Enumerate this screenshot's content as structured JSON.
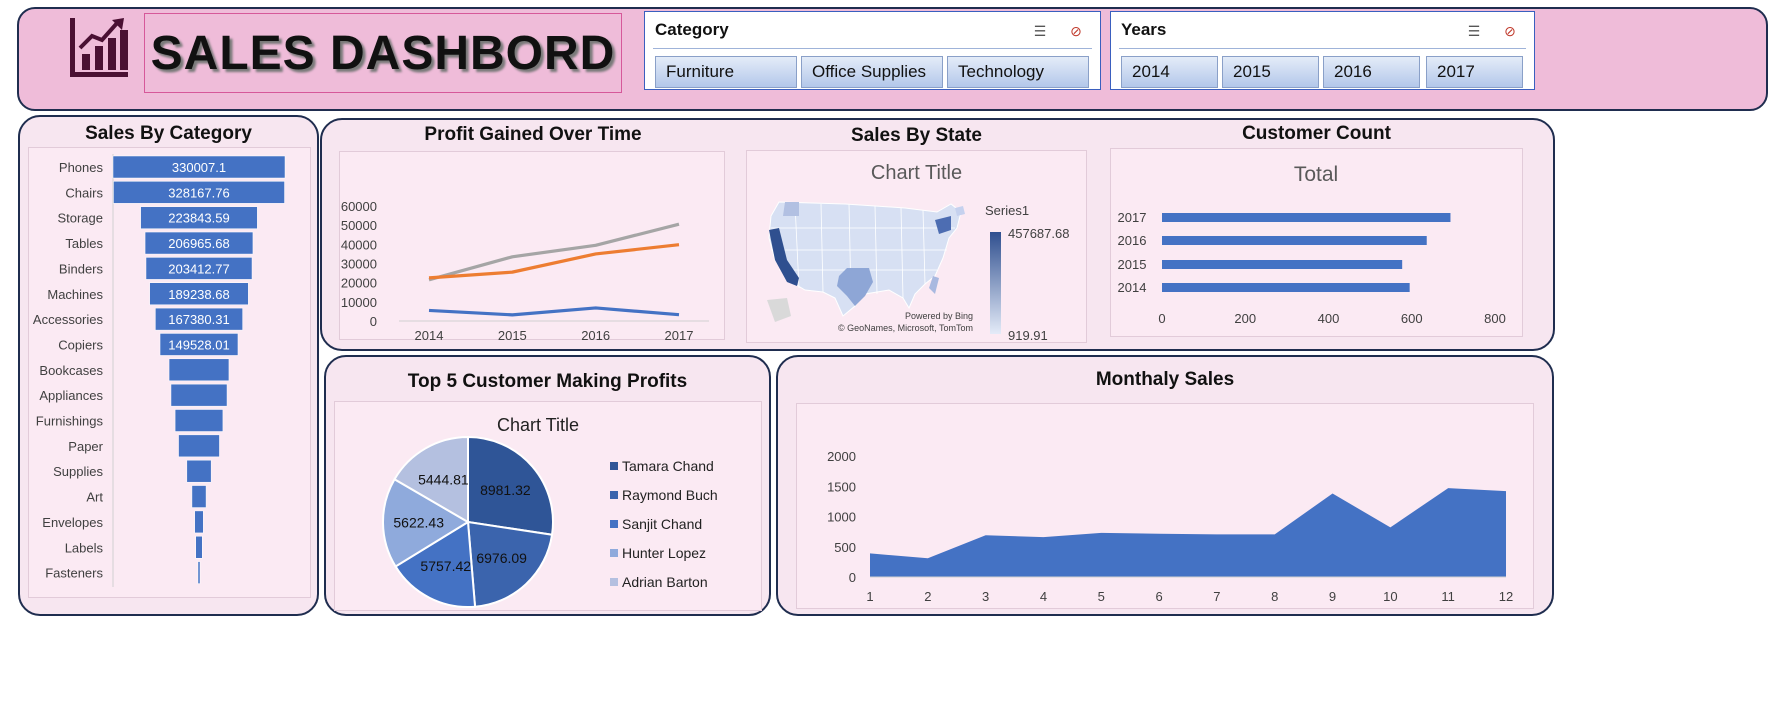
{
  "header": {
    "title": "SALES DASHBORD",
    "logo_icon": "bar-chart-growth-icon",
    "category_slicer": {
      "title": "Category",
      "items": [
        "Furniture",
        "Office Supplies",
        "Technology"
      ],
      "multiselect_icon": "multi-select-icon",
      "clear_filter_icon": "clear-filter-icon"
    },
    "years_slicer": {
      "title": "Years",
      "items": [
        "2014",
        "2015",
        "2016",
        "2017"
      ],
      "multiselect_icon": "multi-select-icon",
      "clear_filter_icon": "clear-filter-icon"
    }
  },
  "colors": {
    "accent_bar": "#4472c4",
    "panel_bg": "#f7e6f0",
    "header_bg": "#efbcd9",
    "border": "#1f2d4f"
  },
  "panels": {
    "sales_by_category": "Sales By Category",
    "profit_over_time": "Profit Gained Over Time",
    "sales_by_state": "Sales By State",
    "customer_count": "Customer Count",
    "top5_customers": "Top 5 Customer Making Profits",
    "monthly_sales": "Monthaly Sales"
  },
  "chart_data": [
    {
      "type": "bar",
      "orientation": "horizontal-funnel",
      "title": "Sales By Category",
      "categories": [
        "Phones",
        "Chairs",
        "Storage",
        "Tables",
        "Binders",
        "Machines",
        "Accessories",
        "Copiers",
        "Bookcases",
        "Appliances",
        "Furnishings",
        "Paper",
        "Supplies",
        "Art",
        "Envelopes",
        "Labels",
        "Fasteners"
      ],
      "values": [
        330007.1,
        328167.76,
        223843.59,
        206965.68,
        203412.77,
        189238.68,
        167380.31,
        149528.01,
        114880.0,
        107532.16,
        91705.16,
        78479.21,
        46673.54,
        27118.79,
        16476.4,
        12486.31,
        3024.28
      ],
      "data_labels": [
        "330007.1",
        "328167.76",
        "223843.59",
        "206965.68",
        "203412.77",
        "189238.68",
        "167380.31",
        "149528.01",
        "",
        "",
        "",
        "",
        "",
        "",
        "",
        "",
        ""
      ]
    },
    {
      "type": "line",
      "title": "Profit Gained Over Time",
      "x": [
        "2014",
        "2015",
        "2016",
        "2017"
      ],
      "y_ticks": [
        "0",
        "10000",
        "20000",
        "30000",
        "40000",
        "50000",
        "60000"
      ],
      "ylim": [
        0,
        60000
      ],
      "series": [
        {
          "color": "#a5a5a5",
          "values": [
            21500,
            33500,
            39500,
            50500
          ]
        },
        {
          "color": "#ed7d31",
          "values": [
            22500,
            25500,
            35000,
            39800
          ]
        },
        {
          "color": "#4472c4",
          "values": [
            5500,
            3200,
            6800,
            3300
          ]
        }
      ]
    },
    {
      "type": "map",
      "title": "Chart Title",
      "legend_title": "Series1",
      "legend_max": "457687.68",
      "legend_min": "919.91",
      "attribution_1": "Powered by Bing",
      "attribution_2": "© GeoNames, Microsoft, TomTom"
    },
    {
      "type": "bar",
      "orientation": "horizontal",
      "title": "Total",
      "categories": [
        "2017",
        "2016",
        "2015",
        "2014"
      ],
      "values": [
        693,
        636,
        577,
        595
      ],
      "x_ticks": [
        "0",
        "200",
        "400",
        "600",
        "800"
      ],
      "xlim": [
        0,
        800
      ]
    },
    {
      "type": "pie",
      "title": "Chart Title",
      "labels": [
        "Tamara Chand",
        "Raymond Buch",
        "Sanjit Chand",
        "Hunter Lopez",
        "Adrian Barton"
      ],
      "values": [
        8981.32,
        6976.09,
        5757.42,
        5622.43,
        5444.81
      ],
      "data_labels": [
        "8981.32",
        "6976.09",
        "5757.42",
        "5622.43",
        "5444.81"
      ],
      "colors": [
        "#2f5597",
        "#3b64ad",
        "#4472c4",
        "#8faadc",
        "#b4c0e0"
      ]
    },
    {
      "type": "area",
      "title": "Monthaly Sales",
      "x": [
        "1",
        "2",
        "3",
        "4",
        "5",
        "6",
        "7",
        "8",
        "9",
        "10",
        "11",
        "12"
      ],
      "values": [
        390,
        310,
        690,
        660,
        730,
        715,
        705,
        705,
        1380,
        820,
        1470,
        1420
      ],
      "y_ticks": [
        "0",
        "500",
        "1000",
        "1500",
        "2000"
      ],
      "ylim": [
        0,
        2000
      ]
    }
  ]
}
